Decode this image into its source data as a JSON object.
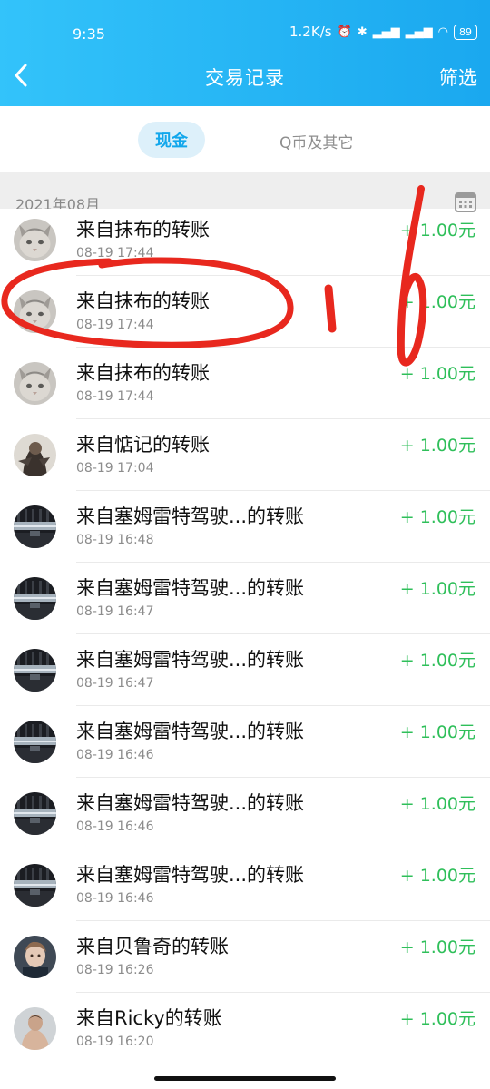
{
  "status_bar": {
    "time": "9:35",
    "network_speed": "1.2K/s",
    "battery": "89"
  },
  "header": {
    "title": "交易记录",
    "filter_label": "筛选",
    "back_icon": "chevron-left-icon"
  },
  "tabs": {
    "cash": "现金",
    "q_coin": "Q币及其它"
  },
  "month_section": {
    "label": "2021年08月",
    "calendar_icon": "calendar-icon"
  },
  "transactions": [
    {
      "title": "来自抹布的转账",
      "time": "08-19 17:44",
      "amount": "+ 1.00元",
      "avatar": "cat"
    },
    {
      "title": "来自抹布的转账",
      "time": "08-19 17:44",
      "amount": "+ 1.00元",
      "avatar": "cat"
    },
    {
      "title": "来自抹布的转账",
      "time": "08-19 17:44",
      "amount": "+ 1.00元",
      "avatar": "cat"
    },
    {
      "title": "来自惦记的转账",
      "time": "08-19 17:04",
      "amount": "+ 1.00元",
      "avatar": "figure"
    },
    {
      "title": "来自塞姆雷特驾驶...的转账",
      "time": "08-19 16:48",
      "amount": "+ 1.00元",
      "avatar": "room"
    },
    {
      "title": "来自塞姆雷特驾驶...的转账",
      "time": "08-19 16:47",
      "amount": "+ 1.00元",
      "avatar": "room"
    },
    {
      "title": "来自塞姆雷特驾驶...的转账",
      "time": "08-19 16:47",
      "amount": "+ 1.00元",
      "avatar": "room"
    },
    {
      "title": "来自塞姆雷特驾驶...的转账",
      "time": "08-19 16:46",
      "amount": "+ 1.00元",
      "avatar": "room"
    },
    {
      "title": "来自塞姆雷特驾驶...的转账",
      "time": "08-19 16:46",
      "amount": "+ 1.00元",
      "avatar": "room"
    },
    {
      "title": "来自塞姆雷特驾驶...的转账",
      "time": "08-19 16:46",
      "amount": "+ 1.00元",
      "avatar": "room"
    },
    {
      "title": "来自贝鲁奇的转账",
      "time": "08-19 16:26",
      "amount": "+ 1.00元",
      "avatar": "child"
    },
    {
      "title": "来自Ricky的转账",
      "time": "08-19 16:20",
      "amount": "+ 1.00元",
      "avatar": "person"
    }
  ],
  "colors": {
    "header_gradient_start": "#33c3fa",
    "header_gradient_end": "#1aa8ef",
    "active_tab_text": "#12a7ec",
    "amount_green": "#2fbf5a",
    "annotation_red": "#e8281e"
  }
}
